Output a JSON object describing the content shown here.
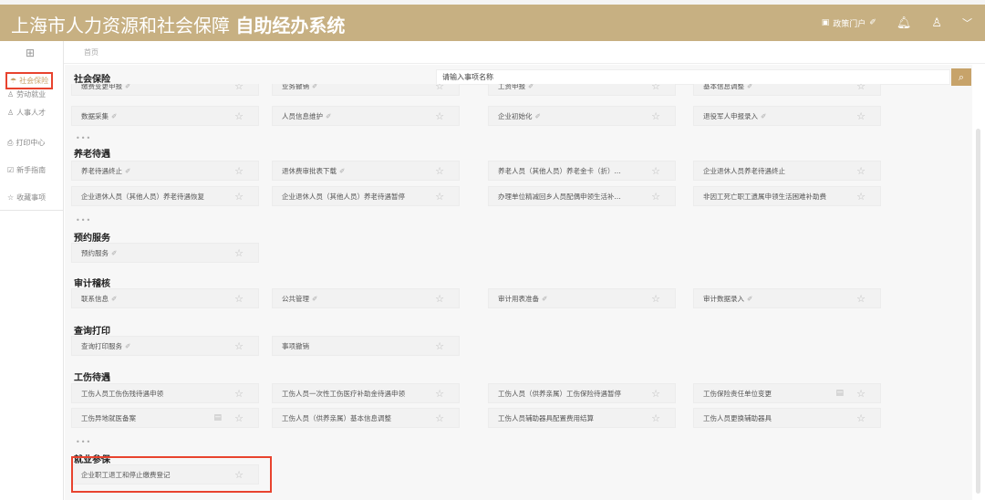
{
  "header": {
    "title_light": "上海市人力资源和社会保障",
    "title_bold": "自助经办系统",
    "portal": "政策门户",
    "icons": [
      "monitor-icon",
      "bell-icon",
      "user-icon",
      "chevron-down-icon"
    ]
  },
  "breadcrumb": "首页",
  "sidebar": [
    {
      "label": "社会保险",
      "icon": "umbrella-icon"
    },
    {
      "label": "劳动就业",
      "icon": "person-icon"
    },
    {
      "label": "人事人才",
      "icon": "people-icon"
    },
    {
      "label": "打印中心",
      "icon": "printer-icon"
    },
    {
      "label": "新手指南",
      "icon": "guide-icon"
    },
    {
      "label": "收藏事项",
      "icon": "star-icon"
    }
  ],
  "search": {
    "placeholder": "请输入事项名称"
  },
  "sections": [
    {
      "title": "社会保险",
      "rows": [
        [
          "缴费变更申报",
          "业务撤销",
          "工资申报",
          "基本信息调整"
        ],
        [
          "数据采集",
          "人员信息维护",
          "企业初始化",
          "退役军人申报录入"
        ]
      ]
    },
    {
      "title": "养老待遇",
      "rows": [
        [
          "养老待遇终止",
          "退休费审批表下载",
          "养老人员（其他人员）养老金卡（折）...",
          "企业退休人员养老待遇终止"
        ],
        [
          "企业退休人员（其他人员）养老待遇恢复",
          "企业退休人员（其他人员）养老待遇暂停",
          "办理单位精减回乡人员配偶申领生活补...",
          "非因工死亡职工遗属申领生活困难补助费"
        ]
      ]
    },
    {
      "title": "预约服务",
      "rows": [
        [
          "预约服务"
        ]
      ]
    },
    {
      "title": "审计稽核",
      "rows": [
        [
          "联系信息",
          "公共管理",
          "审计用表准备",
          "审计数据录入"
        ]
      ]
    },
    {
      "title": "查询打印",
      "rows": [
        [
          "查询打印服务",
          "事项撤销"
        ]
      ]
    },
    {
      "title": "工伤待遇",
      "rows": [
        [
          "工伤人员工伤伤残待遇申领",
          "工伤人员一次性工伤医疗补助金待遇申领",
          "工伤人员（供养亲属）工伤保险待遇暂停",
          "工伤保险责任单位变更"
        ],
        [
          "工伤异地就医备案",
          "工伤人员（供养亲属）基本信息调整",
          "工伤人员辅助器具配置费用结算",
          "工伤人员更换辅助器具"
        ]
      ]
    },
    {
      "title": "就业参保",
      "rows": [
        [
          "企业职工退工和停止缴费登记"
        ]
      ]
    }
  ],
  "more": "..."
}
